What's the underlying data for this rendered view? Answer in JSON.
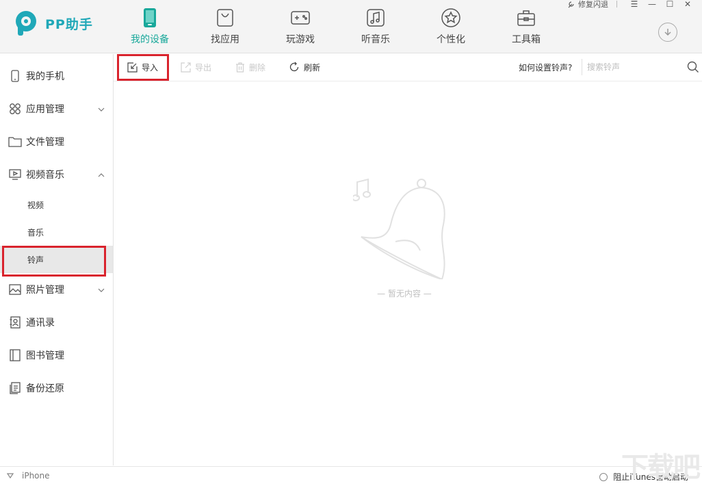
{
  "app": {
    "name": "PP助手",
    "brand_color": "#20a8b8",
    "active_color": "#18a89a"
  },
  "window": {
    "repair_label": "修复闪退",
    "menu_icon": "menu-icon",
    "minimize_icon": "minimize-icon",
    "maximize_icon": "maximize-icon",
    "close_icon": "close-icon"
  },
  "nav": {
    "items": [
      {
        "label": "我的设备",
        "icon": "device-icon",
        "active": true
      },
      {
        "label": "找应用",
        "icon": "bag-icon",
        "active": false
      },
      {
        "label": "玩游戏",
        "icon": "gamepad-icon",
        "active": false
      },
      {
        "label": "听音乐",
        "icon": "music-icon",
        "active": false
      },
      {
        "label": "个性化",
        "icon": "star-icon",
        "active": false
      },
      {
        "label": "工具箱",
        "icon": "toolbox-icon",
        "active": false
      }
    ],
    "download_icon": "download-icon"
  },
  "sidebar": {
    "items": [
      {
        "label": "我的手机",
        "icon": "phone-icon"
      },
      {
        "label": "应用管理",
        "icon": "apps-icon",
        "chevron": "chevron-down-icon"
      },
      {
        "label": "文件管理",
        "icon": "folder-icon"
      },
      {
        "label": "视频音乐",
        "icon": "video-music-icon",
        "chevron": "chevron-up-icon"
      },
      {
        "label": "照片管理",
        "icon": "photo-icon",
        "chevron": "chevron-down-icon"
      },
      {
        "label": "通讯录",
        "icon": "contacts-icon"
      },
      {
        "label": "图书管理",
        "icon": "book-icon"
      },
      {
        "label": "备份还原",
        "icon": "backup-icon"
      }
    ],
    "sub_items": [
      {
        "label": "视频",
        "active": false
      },
      {
        "label": "音乐",
        "active": false
      },
      {
        "label": "铃声",
        "active": true
      }
    ]
  },
  "toolbar": {
    "import_label": "导入",
    "export_label": "导出",
    "delete_label": "删除",
    "refresh_label": "刷新",
    "help_label": "如何设置铃声?",
    "search_placeholder": "搜索铃声"
  },
  "content": {
    "empty_text": "— 暂无内容 —"
  },
  "statusbar": {
    "device_name": "iPhone",
    "itunes_label": "阻止iTunes自动启动"
  },
  "highlight_color": "#d9232d",
  "watermark": "下载吧"
}
